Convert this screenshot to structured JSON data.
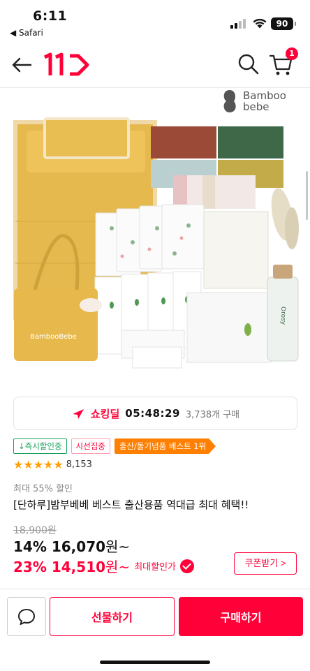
{
  "status_bar": {
    "time": "6:11",
    "back_app": "◀ Safari",
    "battery": "90"
  },
  "nav": {
    "logo": "11",
    "cart_count": "1"
  },
  "product_image": {
    "brand_line1": "Bamboo",
    "brand_line2": "bebe",
    "bag_text": "BambooBebe",
    "bottle_text": "Orosy"
  },
  "deal": {
    "label": "쇼킹딜",
    "timer": "05:48:29",
    "purchase_count": "3,738개 구매"
  },
  "tags": {
    "instant": "↓즉시할인중",
    "focus": "시선집중",
    "best": "출산/돌기념품 베스트 1위"
  },
  "rating": {
    "stars": "★★★★★",
    "count": "8,153"
  },
  "product": {
    "discount_note": "최대 55% 할인",
    "title": "[단하루]밤부베베 베스트 출산용품 역대급 최대 혜택!!",
    "original_price": "18,900원",
    "price_pct": "14%",
    "price": "16,070",
    "price_suffix": "원~",
    "max_pct": "23%",
    "max_price": "14,510",
    "max_suffix": "원~",
    "max_label": "최대할인가",
    "coupon_label": "쿠폰받기 >"
  },
  "bottom_bar": {
    "gift_label": "선물하기",
    "buy_label": "구매하기"
  },
  "colors": {
    "accent": "#ff0038",
    "star": "#ff9f00",
    "green_tag": "#19a15a",
    "orange_tag": "#ff7f00"
  }
}
